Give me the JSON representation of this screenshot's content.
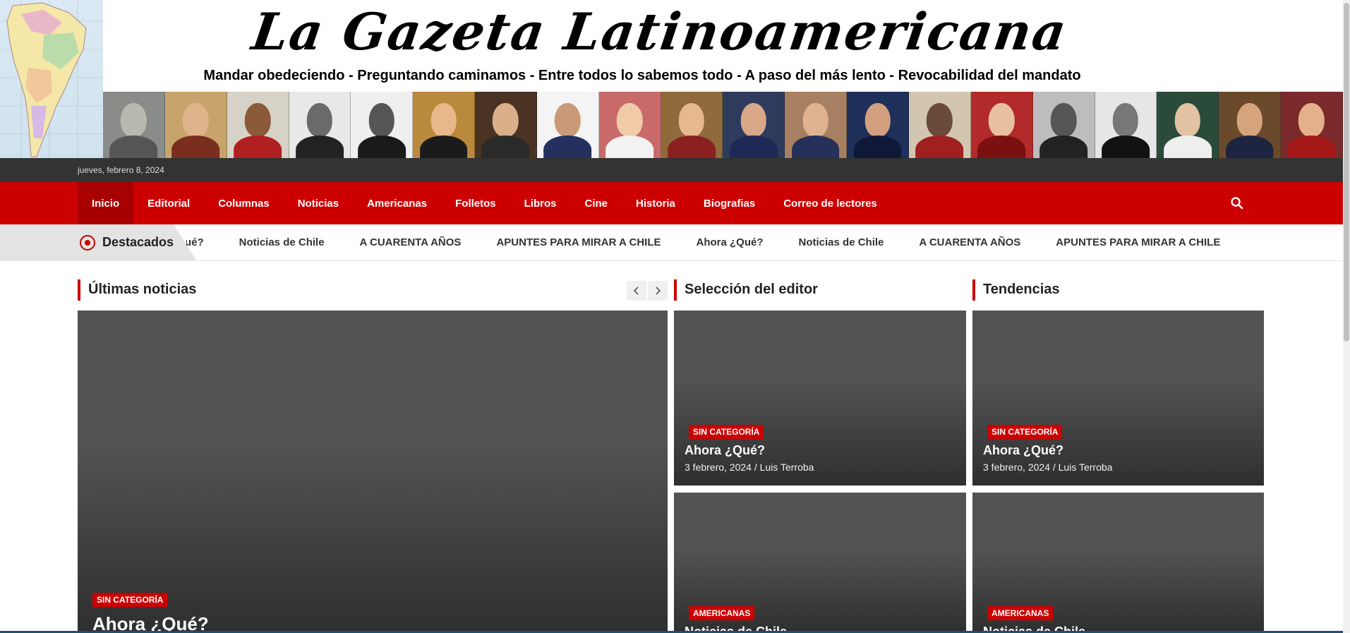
{
  "header": {
    "site_title": "La Gazeta Latinoamericana",
    "tagline": "Mandar obedeciendo - Preguntando caminamos - Entre todos lo sabemos todo - A paso del más lento - Revocabilidad del mandato"
  },
  "topbar": {
    "date": "jueves, febrero 8, 2024"
  },
  "nav": {
    "items": [
      {
        "label": "Inicio",
        "active": true
      },
      {
        "label": "Editorial"
      },
      {
        "label": "Columnas"
      },
      {
        "label": "Noticias"
      },
      {
        "label": "Americanas"
      },
      {
        "label": "Folletos"
      },
      {
        "label": "Libros"
      },
      {
        "label": "Cine"
      },
      {
        "label": "Historia"
      },
      {
        "label": "Biografias"
      },
      {
        "label": "Correo de lectores"
      }
    ],
    "search_icon": "search-icon"
  },
  "ticker": {
    "label": "Destacados",
    "items": [
      "ué?",
      "Noticias de Chile",
      "A CUARENTA AÑOS",
      "APUNTES PARA MIRAR A CHILE",
      "Ahora ¿Qué?",
      "Noticias de Chile",
      "A CUARENTA AÑOS",
      "APUNTES PARA MIRAR A CHILE"
    ]
  },
  "sections": {
    "latest": "Últimas noticias",
    "editor": "Selección del editor",
    "trending": "Tendencias"
  },
  "cards": {
    "main": {
      "category": "SIN CATEGORÍA",
      "title": "Ahora ¿Qué?"
    },
    "editor_1": {
      "category": "SIN CATEGORÍA",
      "title": "Ahora ¿Qué?",
      "date": "3 febrero, 2024",
      "author": "Luis Terroba"
    },
    "editor_2": {
      "category": "AMERICANAS",
      "title": "Noticias de Chile"
    },
    "trend_1": {
      "category": "SIN CATEGORÍA",
      "title": "Ahora ¿Qué?",
      "date": "3 febrero, 2024",
      "author": "Luis Terroba"
    },
    "trend_2": {
      "category": "AMERICANAS",
      "title": "Noticias de Chile"
    }
  },
  "colors": {
    "accent": "#cc0000",
    "topbar": "#333333",
    "card_bg": "#535353"
  }
}
